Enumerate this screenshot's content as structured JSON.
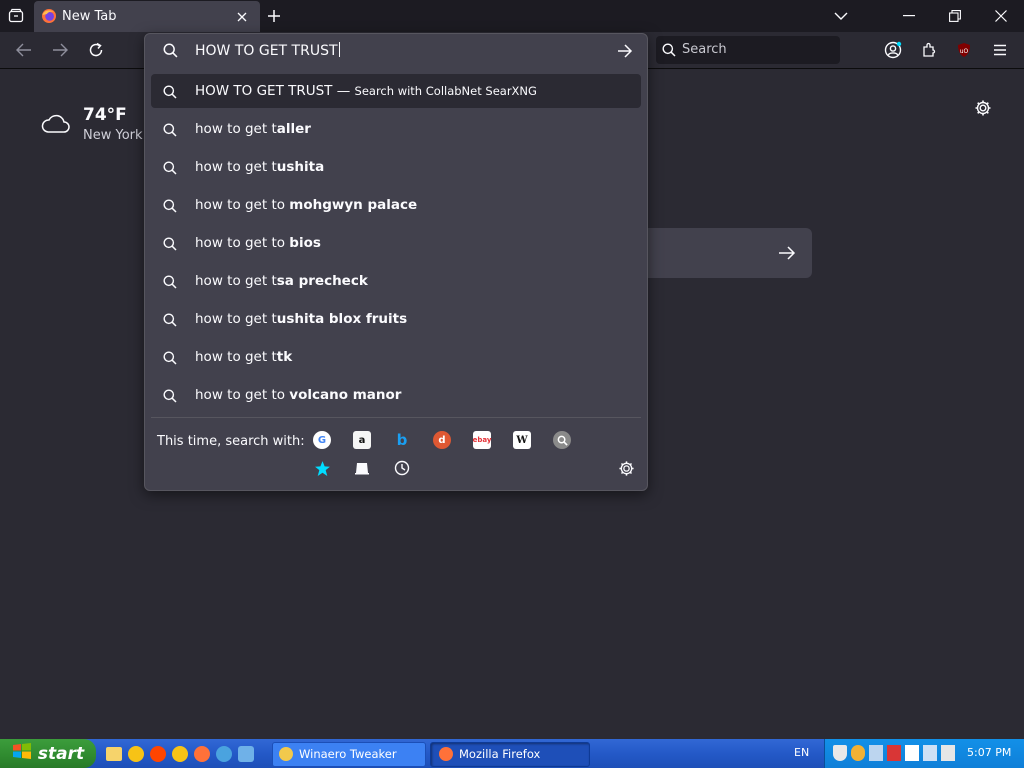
{
  "browser": {
    "tab_title": "New Tab",
    "search_placeholder": "Search"
  },
  "urlbar": {
    "value": "HOW TO GET TRUST"
  },
  "weather": {
    "temp": "74°F",
    "location": "New York"
  },
  "dropdown": {
    "primary": {
      "text": "HOW TO GET TRUST",
      "sep": "—",
      "engine_hint": "Search with CollabNet SearXNG"
    },
    "suggestions": [
      {
        "prefix": "how to get t",
        "bold": "aller"
      },
      {
        "prefix": "how to get t",
        "bold": "ushita"
      },
      {
        "prefix": "how to get to ",
        "bold": "mohgwyn palace"
      },
      {
        "prefix": "how to get to ",
        "bold": "bios"
      },
      {
        "prefix": "how to get t",
        "bold": "sa precheck"
      },
      {
        "prefix": "how to get t",
        "bold": "ushita blox fruits"
      },
      {
        "prefix": "how to get t",
        "bold": "tk"
      },
      {
        "prefix": "how to get to ",
        "bold": "volcano manor"
      }
    ],
    "oneoff_label": "This time, search with:",
    "engines": [
      "google-icon",
      "amazon-icon",
      "bing-icon",
      "duckduckgo-icon",
      "ebay-icon",
      "wikipedia-icon",
      "searxng-icon"
    ],
    "modes": [
      "bookmarks-icon",
      "tabs-icon",
      "history-icon"
    ]
  },
  "taskbar": {
    "start_label": "start",
    "tasks": [
      "Winaero Tweaker",
      "Mozilla Firefox"
    ],
    "lang": "EN",
    "clock": "5:07 PM"
  },
  "colors": {
    "accent": "#0061e0",
    "xp_blue": "#245edb",
    "xp_green": "#2f8a2f"
  }
}
